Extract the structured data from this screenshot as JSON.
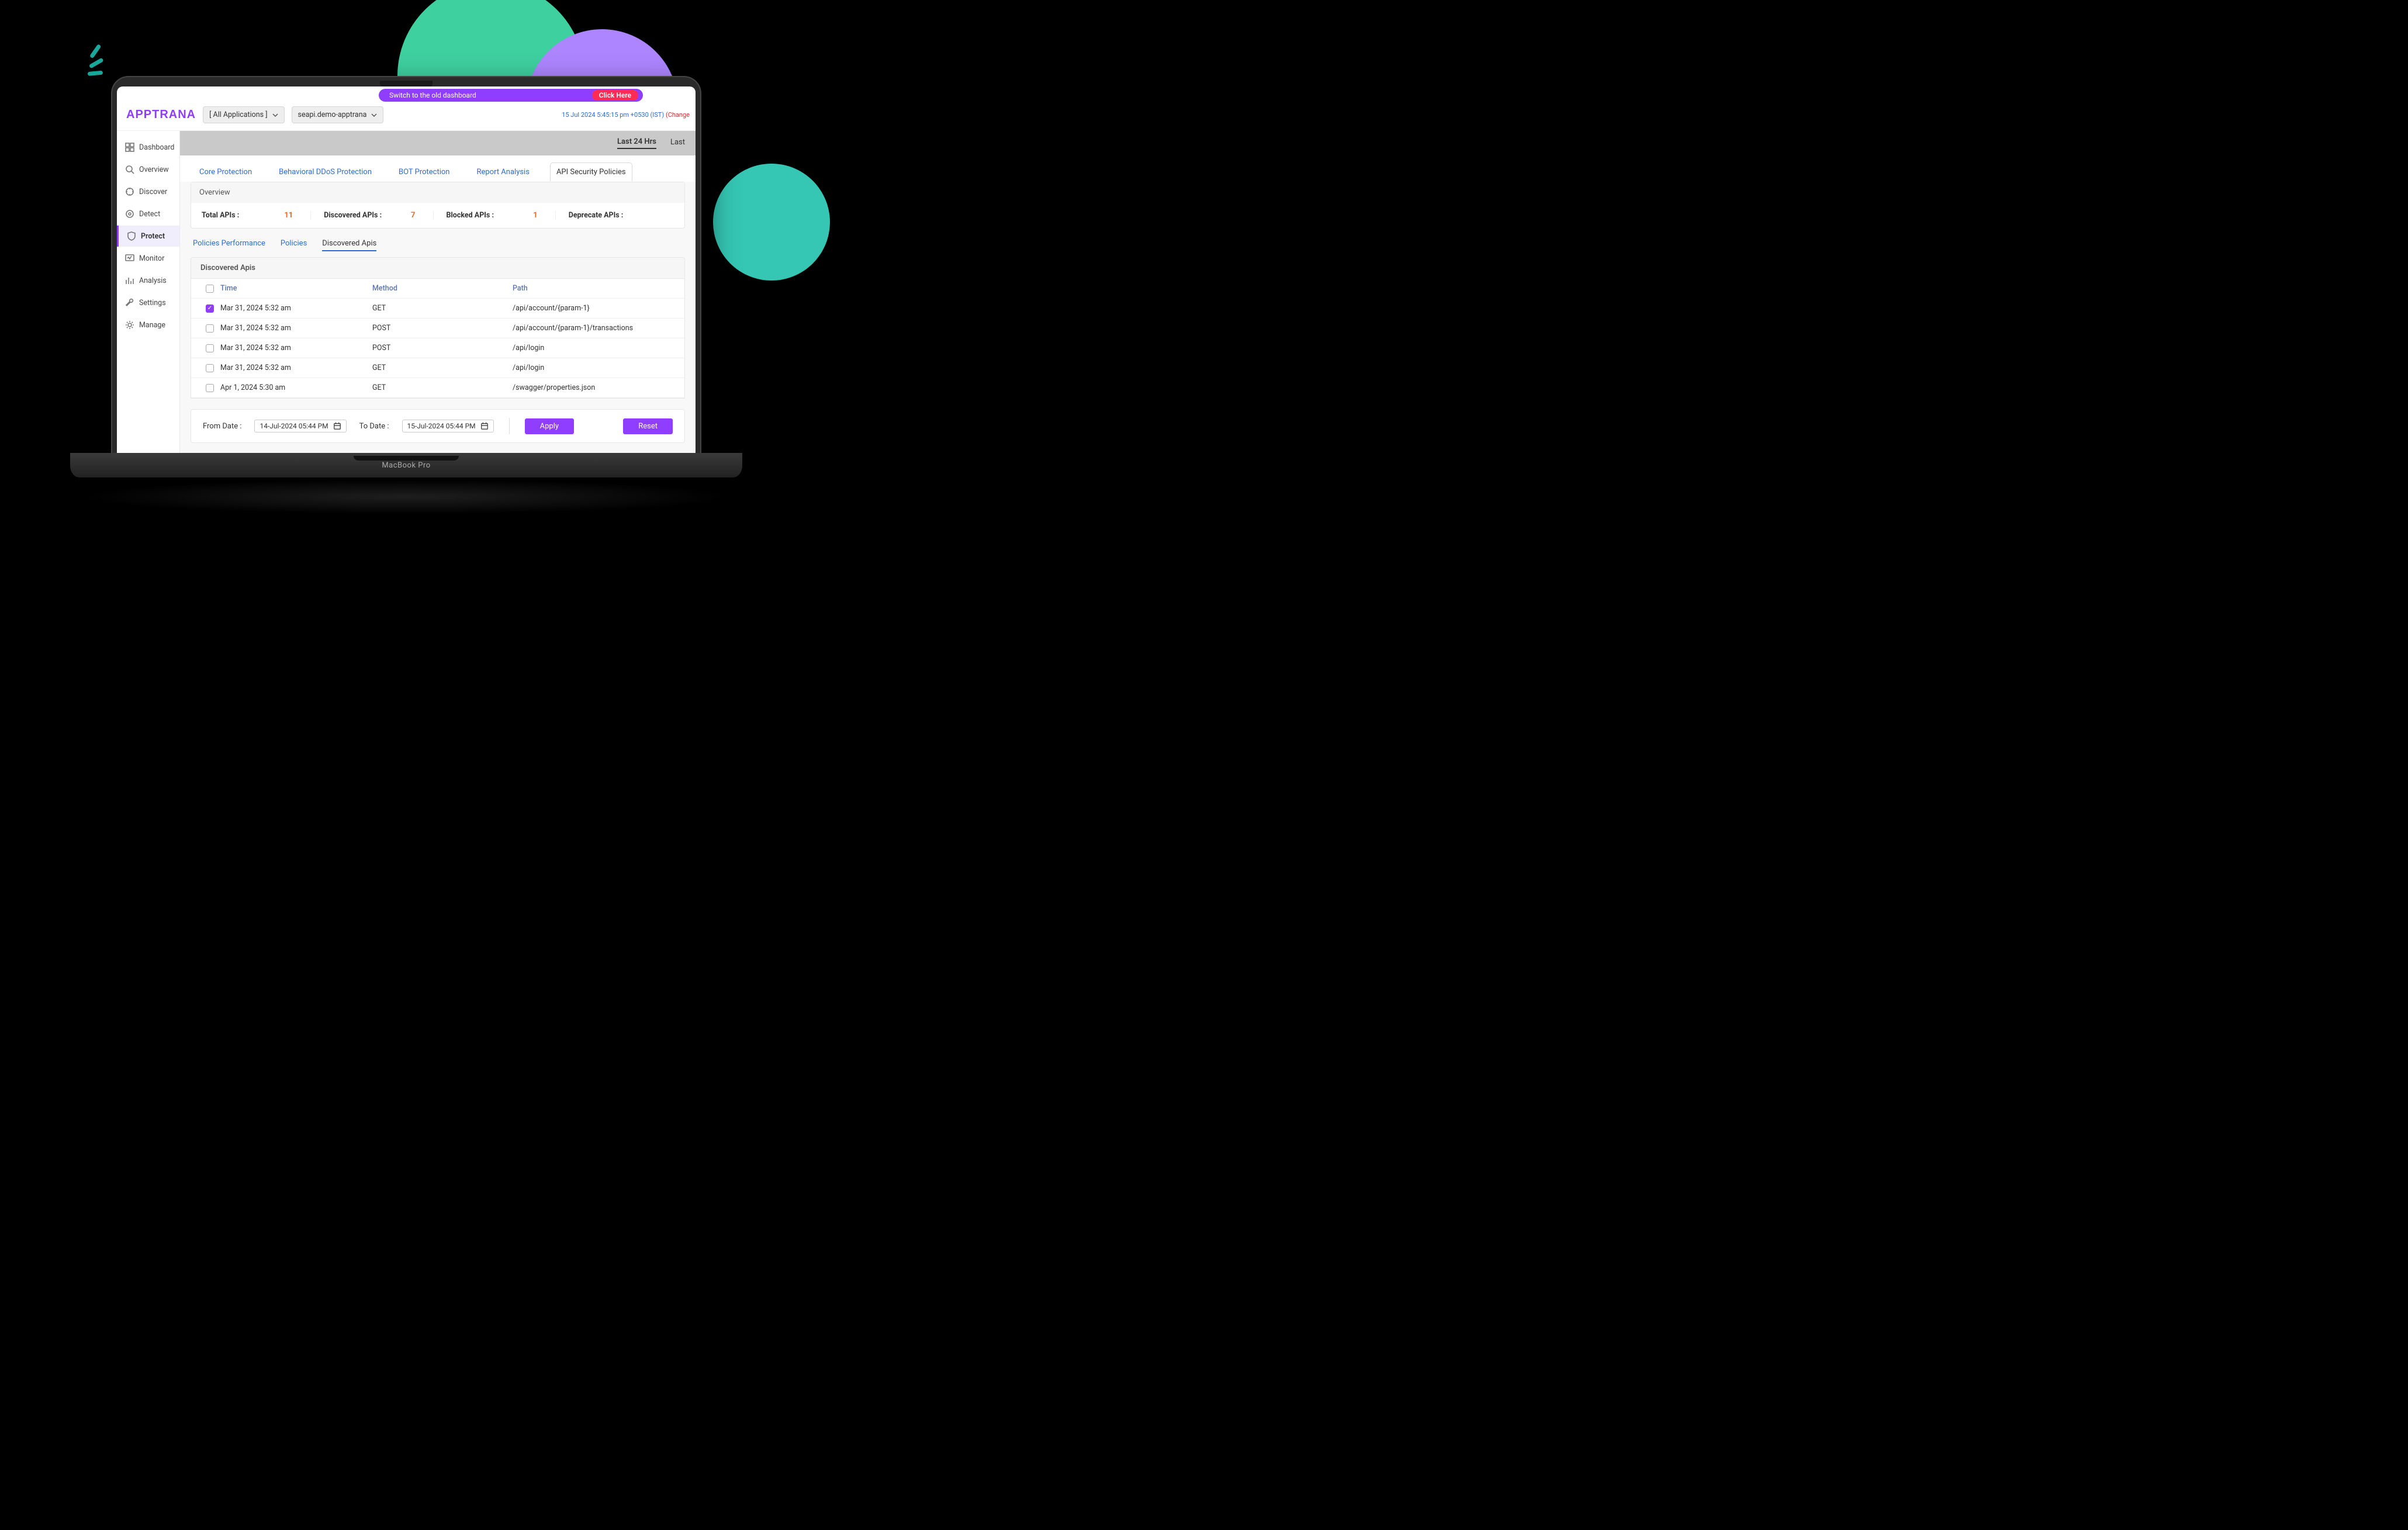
{
  "brand": "APPTRANA",
  "banner": {
    "text": "Switch to the old dashboard",
    "cta": "Click Here"
  },
  "dropdowns": {
    "apps": "[ All Applications ]",
    "domain": "seapi.demo-apptrana"
  },
  "timestamp": {
    "text": "15 Jul 2024 5:45:15 pm +0530 (IST)",
    "change": "(Change"
  },
  "sidebar": {
    "items": [
      {
        "label": "Dashboard"
      },
      {
        "label": "Overview"
      },
      {
        "label": "Discover"
      },
      {
        "label": "Detect"
      },
      {
        "label": "Protect"
      },
      {
        "label": "Monitor"
      },
      {
        "label": "Analysis"
      },
      {
        "label": "Settings"
      },
      {
        "label": "Manage"
      }
    ]
  },
  "time_range": {
    "items": [
      "Last 24 Hrs",
      "Last"
    ]
  },
  "tabs": [
    "Core Protection",
    "Behavioral DDoS Protection",
    "BOT Protection",
    "Report Analysis",
    "API Security Policies"
  ],
  "overview": {
    "title": "Overview",
    "stats": [
      {
        "label": "Total APIs :",
        "value": "11"
      },
      {
        "label": "Discovered APIs :",
        "value": "7"
      },
      {
        "label": "Blocked APIs :",
        "value": "1"
      },
      {
        "label": "Deprecate APIs :",
        "value": ""
      }
    ]
  },
  "subtabs": [
    "Policies Performance",
    "Policies",
    "Discovered Apis"
  ],
  "discovered": {
    "title": "Discovered Apis",
    "headers": {
      "time": "Time",
      "method": "Method",
      "path": "Path"
    },
    "rows": [
      {
        "checked": true,
        "time": "Mar 31, 2024 5:32 am",
        "method": "GET",
        "path": "/api/account/{param-1}"
      },
      {
        "checked": false,
        "time": "Mar 31, 2024 5:32 am",
        "method": "POST",
        "path": "/api/account/{param-1}/transactions"
      },
      {
        "checked": false,
        "time": "Mar 31, 2024 5:32 am",
        "method": "POST",
        "path": "/api/login"
      },
      {
        "checked": false,
        "time": "Mar 31, 2024 5:32 am",
        "method": "GET",
        "path": "/api/login"
      },
      {
        "checked": false,
        "time": "Apr 1, 2024 5:30 am",
        "method": "GET",
        "path": "/swagger/properties.json"
      }
    ]
  },
  "datebar": {
    "from_label": "From Date :",
    "from_value": "14-Jul-2024 05:44 PM",
    "to_label": "To Date :",
    "to_value": "15-Jul-2024 05:44 PM",
    "apply": "Apply",
    "reset": "Reset"
  },
  "device": "MacBook Pro"
}
